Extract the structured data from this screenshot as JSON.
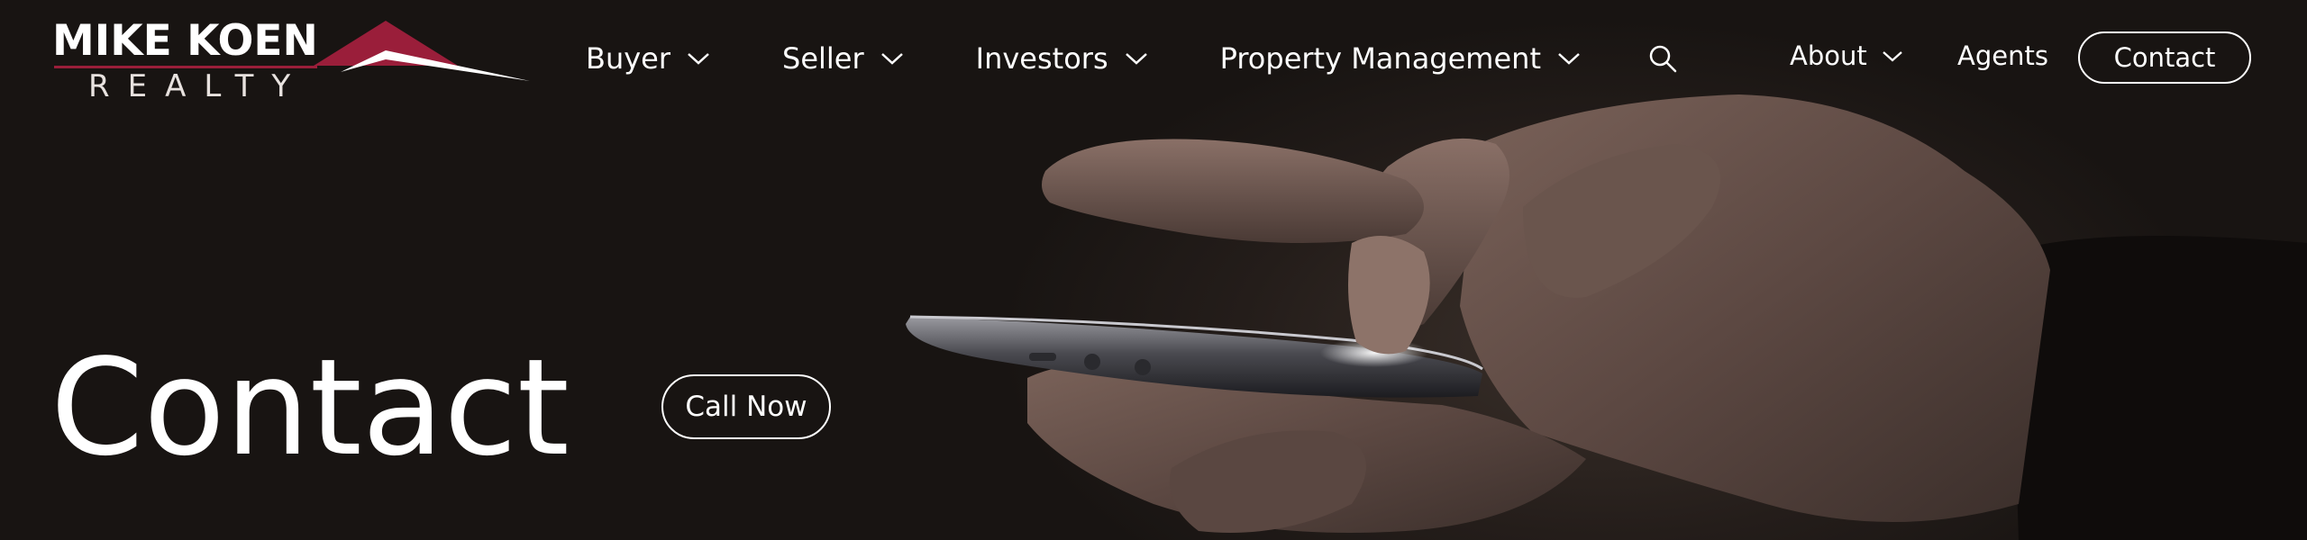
{
  "brand": {
    "name_line1": "MIKE KOEN",
    "name_line2": "REALTY",
    "accent_color": "#9a1e3a"
  },
  "nav": {
    "items": [
      {
        "label": "Buyer",
        "icon": "chevron-down-icon"
      },
      {
        "label": "Seller",
        "icon": "chevron-down-icon"
      },
      {
        "label": "Investors",
        "icon": "chevron-down-icon"
      },
      {
        "label": "Property Management",
        "icon": "chevron-down-icon"
      }
    ],
    "search_icon": "search-icon",
    "about_label": "About",
    "agents_label": "Agents",
    "contact_label": "Contact"
  },
  "hero": {
    "title": "Contact",
    "cta_label": "Call Now",
    "background_image": "hands holding smartphone"
  },
  "colors": {
    "background": "#181412",
    "text": "#ffffff"
  }
}
